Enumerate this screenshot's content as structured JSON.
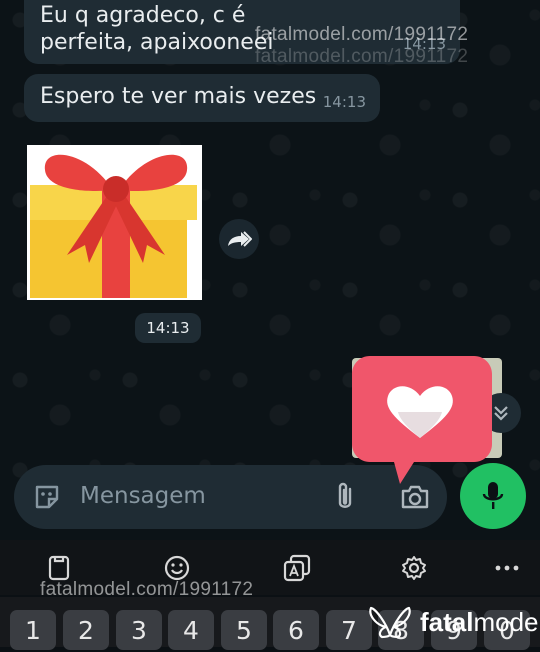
{
  "messages": [
    {
      "text": "Eu q agradeco, c é perfeita, apaixooneei",
      "time": "14:13"
    },
    {
      "text": "Espero te ver mais vezes",
      "time": "14:13"
    }
  ],
  "sticker": {
    "time": "14:13"
  },
  "input": {
    "placeholder": "Mensagem"
  },
  "watermark": {
    "url": "fatalmodel.com/1991172",
    "brand_prefix": "fatal",
    "brand_suffix": "model"
  },
  "keyboard": {
    "numbers": [
      "1",
      "2",
      "3",
      "4",
      "5",
      "6",
      "7",
      "8",
      "9",
      "0"
    ]
  },
  "colors": {
    "bubble": "#1f2c34",
    "send_green": "#21c063",
    "heart_red": "#f0566b"
  }
}
